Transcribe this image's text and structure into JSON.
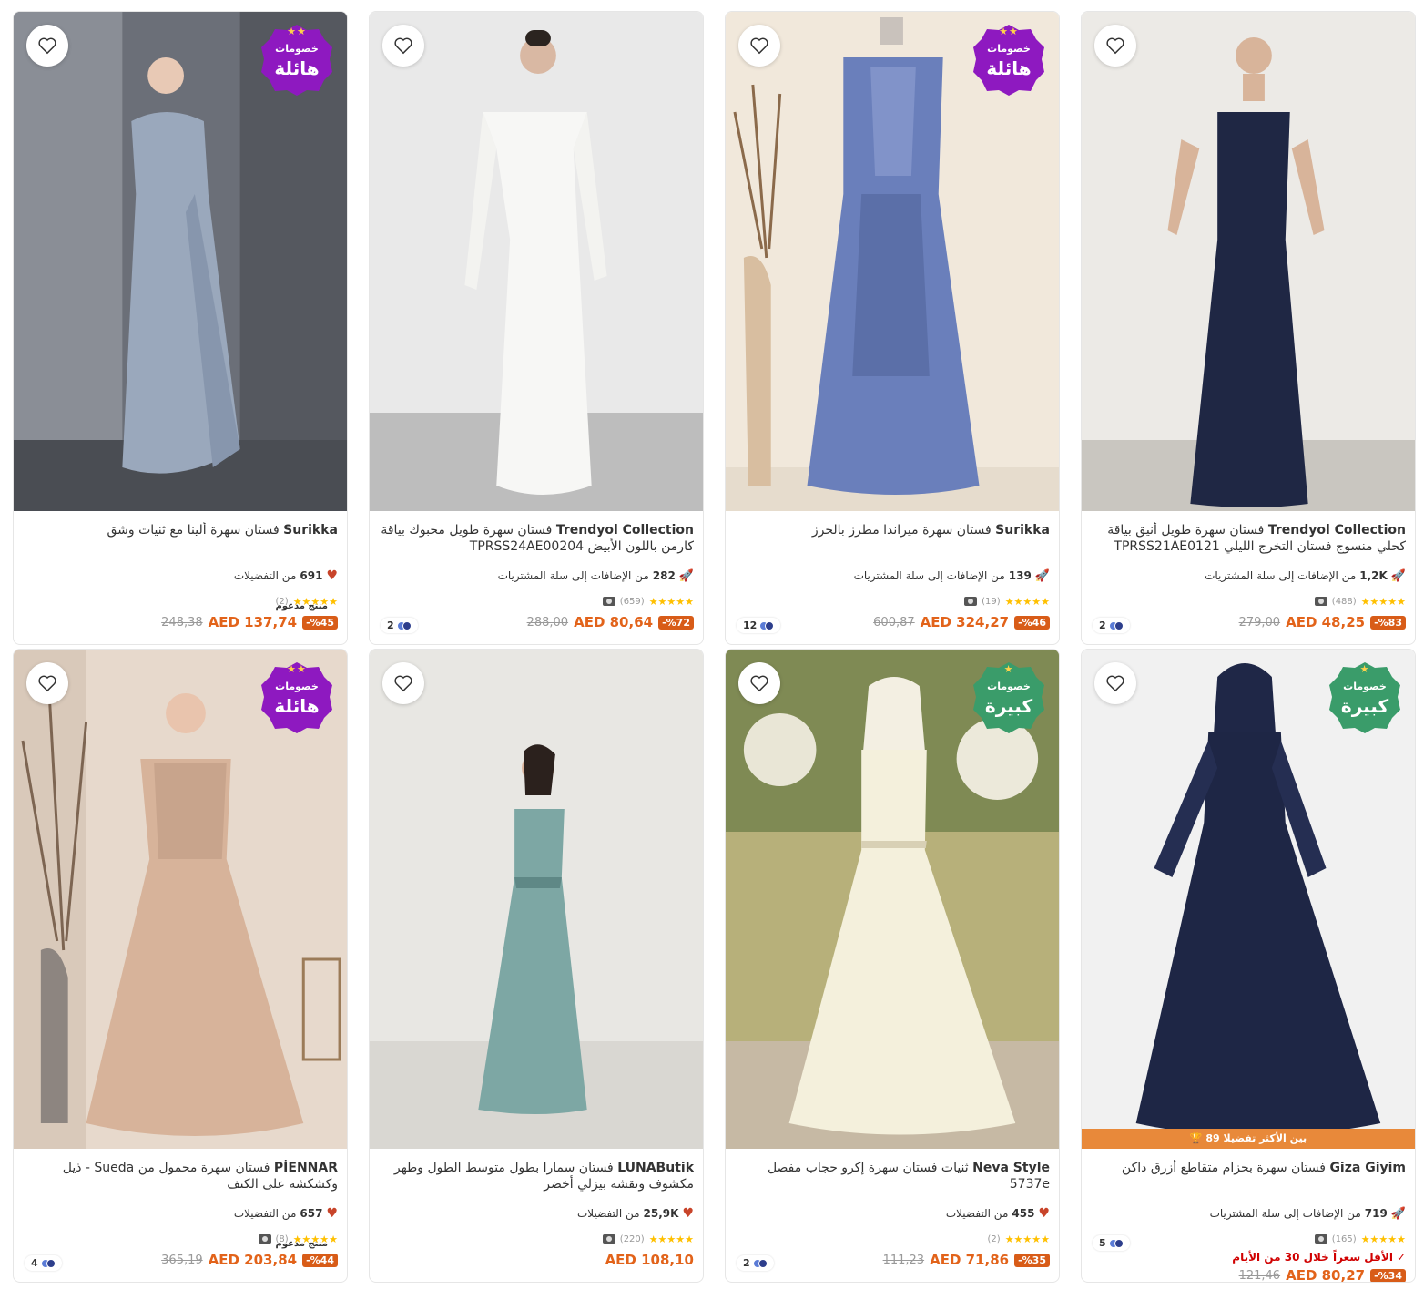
{
  "ui": {
    "colors": {
      "accent": "#f27a1a",
      "price": "#e2631a",
      "purple_badge": "#8e19c0",
      "green_badge": "#3a9c6a",
      "star": "#ffc000"
    },
    "icons": {
      "favorite": "heart-outline-icon",
      "social_fav": "heart-filled-icon",
      "social_cart": "rocket-icon",
      "review_photos": "camera-icon"
    }
  },
  "products": [
    {
      "brand": "Surikka",
      "name": "فستان سهرة ألينا مع ثنيات وشق",
      "badge": {
        "line1": "خصومات",
        "line2": "هائلة",
        "stars": "★★"
      },
      "sponsored": "منتج مدعوم",
      "colors": "",
      "social_count": "691",
      "social_text": "من التفضيلات",
      "stars": "★★★★★",
      "reviews": "(2)",
      "discount": "%45-",
      "price_now": "AED 137,74",
      "price_old": "248,38"
    },
    {
      "brand": "Trendyol Collection",
      "name": "فستان سهرة طويل محبوك بياقة كارمن باللون الأبيض TPRSS24AE00204",
      "badge": null,
      "sponsored": "",
      "colors": "2",
      "social_count": "282",
      "social_text": "من الإضافات إلى سلة المشتريات",
      "stars": "★★★★★",
      "reviews": "(659)",
      "discount": "%72-",
      "price_now": "AED 80,64",
      "price_old": "288,00"
    },
    {
      "brand": "Surikka",
      "name": "فستان سهرة ميراندا مطرز بالخرز",
      "badge": {
        "line1": "خصومات",
        "line2": "هائلة",
        "stars": "★★"
      },
      "sponsored": "",
      "colors": "12",
      "social_count": "139",
      "social_text": "من الإضافات إلى سلة المشتريات",
      "stars": "★★★★★",
      "reviews": "(19)",
      "discount": "%46-",
      "price_now": "AED 324,27",
      "price_old": "600,87"
    },
    {
      "brand": "Trendyol Collection",
      "name": "فستان سهرة طويل أنيق بياقة كحلي منسوج فستان التخرج الليلي TPRSS21AE0121",
      "badge": null,
      "sponsored": "",
      "colors": "2",
      "social_count": "1,2K",
      "social_text": "من الإضافات إلى سلة المشتريات",
      "stars": "★★★★★",
      "reviews": "(488)",
      "discount": "%83-",
      "price_now": "AED 48,25",
      "price_old": "279,00"
    },
    {
      "brand": "PİENNAR",
      "name": "فستان سهرة محمول من Sueda - ذيل وكشكشة على الكتف",
      "badge": {
        "line1": "خصومات",
        "line2": "هائلة",
        "stars": "★★"
      },
      "sponsored": "منتج مدعوم",
      "colors": "4",
      "social_count": "657",
      "social_text": "من التفضيلات",
      "stars": "★★★★★",
      "reviews": "(8)",
      "discount": "%44-",
      "price_now": "AED 203,84",
      "price_old": "365,19"
    },
    {
      "brand": "LUNAButik",
      "name": "فستان سمارا بطول متوسط الطول وظهر مكشوف ونقشة بيزلي أخضر",
      "badge": null,
      "sponsored": "",
      "colors": "",
      "social_count": "25,9K",
      "social_text": "من التفضيلات",
      "stars": "★★★★★",
      "reviews": "(220)",
      "discount": "",
      "price_now": "AED 108,10",
      "price_old": ""
    },
    {
      "brand": "Neva Style",
      "name": "ثنيات فستان سهرة إكرو حجاب مفصل 5737e",
      "badge": {
        "line1": "خصومات",
        "line2": "كبيرة",
        "stars": "★"
      },
      "sponsored": "",
      "colors": "2",
      "social_count": "455",
      "social_text": "من التفضيلات",
      "stars": "★★★★★",
      "reviews": "(2)",
      "discount": "%35-",
      "price_now": "AED 71,86",
      "price_old": "111,23"
    },
    {
      "brand": "Giza Giyim",
      "name": "فستان سهرة بحزام متقاطع أزرق داكن",
      "badge": {
        "line1": "خصومات",
        "line2": "كبيرة",
        "stars": "★"
      },
      "sponsored": "",
      "colors": "5",
      "banner": "89 بين الأكثر تفضيلا",
      "social_count": "719",
      "social_text": "من الإضافات إلى سلة المشتريات",
      "stars": "★★★★★",
      "reviews": "(165)",
      "lowest": "الأقل سعراً خلال 30 من الأيام",
      "discount": "%34-",
      "price_now": "AED 80,27",
      "price_old": "121,46"
    }
  ]
}
